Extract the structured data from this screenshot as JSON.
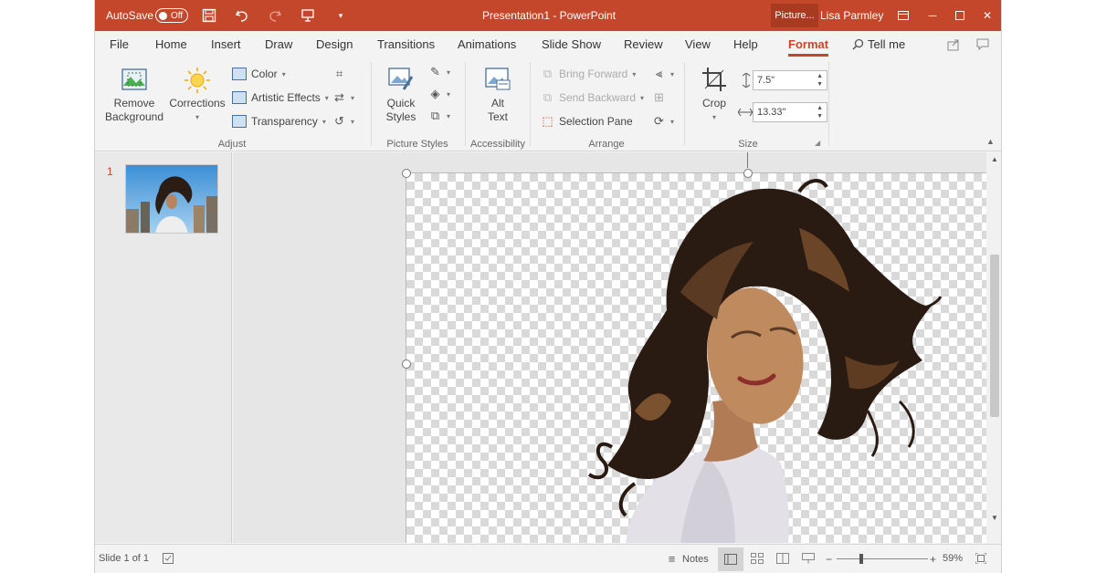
{
  "titlebar": {
    "autosave_label": "AutoSave",
    "autosave_state": "Off",
    "title": "Presentation1  -  PowerPoint",
    "context_tab": "Picture...",
    "user": "Lisa Parmley",
    "icons": [
      "save-icon",
      "undo-icon",
      "redo-icon",
      "start-slideshow-icon",
      "customize-qat-icon"
    ]
  },
  "tabs": {
    "items": [
      "File",
      "Home",
      "Insert",
      "Draw",
      "Design",
      "Transitions",
      "Animations",
      "Slide Show",
      "Review",
      "View",
      "Help",
      "Format"
    ],
    "active": "Format",
    "tellme": "Tell me"
  },
  "ribbon": {
    "adjust": {
      "remove_bg_line1": "Remove",
      "remove_bg_line2": "Background",
      "corrections": "Corrections",
      "color": "Color",
      "artistic": "Artistic Effects",
      "transparency": "Transparency",
      "label": "Adjust"
    },
    "styles": {
      "quick_line1": "Quick",
      "quick_line2": "Styles",
      "label": "Picture Styles"
    },
    "accessibility": {
      "alt_line1": "Alt",
      "alt_line2": "Text",
      "label": "Accessibility"
    },
    "arrange": {
      "bring_forward": "Bring Forward",
      "send_backward": "Send Backward",
      "selection_pane": "Selection Pane",
      "label": "Arrange"
    },
    "size": {
      "crop": "Crop",
      "height": "7.5\"",
      "width": "13.33\"",
      "label": "Size"
    }
  },
  "slides": {
    "number": "1"
  },
  "status": {
    "slide_info": "Slide 1 of 1",
    "notes": "Notes",
    "zoom": "59%",
    "zoom_level": 0.59
  },
  "colors": {
    "accent": "#c4472b",
    "ribbon_bg": "#f3f3f3"
  }
}
